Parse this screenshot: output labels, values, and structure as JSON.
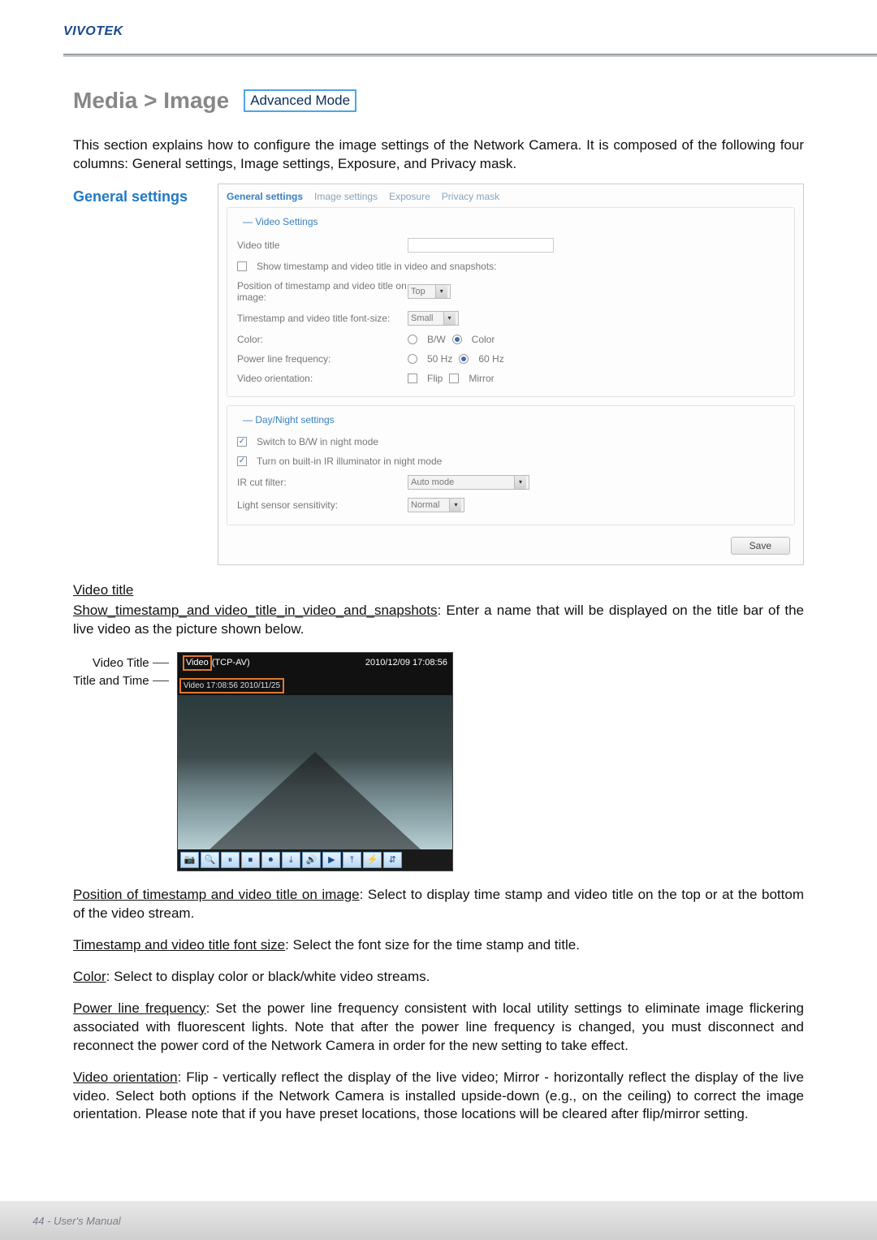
{
  "brand": "VIVOTEK",
  "page_title": "Media > Image",
  "mode_badge": "Advanced Mode",
  "intro": "This section explains how to configure the image settings of the Network Camera. It is composed of the following four columns: General settings, Image settings, Exposure, and Privacy mask.",
  "side_label": "General settings",
  "tabs": [
    "General settings",
    "Image settings",
    "Exposure",
    "Privacy mask"
  ],
  "video_settings": {
    "legend": "Video Settings",
    "video_title_label": "Video title",
    "show_ts_label": "Show timestamp and video title in video and snapshots:",
    "position_label": "Position of timestamp and video title on image:",
    "position_value": "Top",
    "font_label": "Timestamp and video title font-size:",
    "font_value": "Small",
    "color_label": "Color:",
    "color_bw": "B/W",
    "color_color": "Color",
    "plf_label": "Power line frequency:",
    "plf_50": "50 Hz",
    "plf_60": "60 Hz",
    "orient_label": "Video orientation:",
    "orient_flip": "Flip",
    "orient_mirror": "Mirror"
  },
  "daynight": {
    "legend": "Day/Night settings",
    "switch_bw": "Switch to B/W in night mode",
    "ir_illum": "Turn on built-in IR illuminator in night mode",
    "ircut_label": "IR cut filter:",
    "ircut_value": "Auto mode",
    "light_label": "Light sensor sensitivity:",
    "light_value": "Normal"
  },
  "save_label": "Save",
  "body": {
    "h_video_title": "Video title",
    "p_show_ts_u": "Show_timestamp_and video_title_in_video_and_snapshots",
    "p_show_ts_rest": ": Enter a name that will be displayed on the title bar of the live video as the picture shown below.",
    "vb_label1": "Video Title",
    "vb_label2": "Title and Time",
    "vt_box": "Video",
    "vt_rest": "(TCP-AV)",
    "vt_date": "2010/12/09  17:08:56",
    "vt_inner": "Video 17:08:56  2010/11/25",
    "p_pos_u": "Position of timestamp and video title on image",
    "p_pos_rest": ": Select to display time stamp and video title on the top or at the bottom of the video stream.",
    "p_font_u": "Timestamp and video title font size",
    "p_font_rest": ": Select the font size for the time stamp and title.",
    "p_color_u": "Color",
    "p_color_rest": ": Select to display color or black/white video streams.",
    "p_plf_u": "Power line frequency",
    "p_plf_rest": ": Set the power line frequency consistent with local utility settings to eliminate image flickering associated with fluorescent lights. Note that after the power line frequency is changed, you must disconnect and reconnect the power cord of the Network Camera in order for the new setting to take effect.",
    "p_orient_u": "Video orientation",
    "p_orient_rest": ": Flip - vertically reflect the display of the live video; Mirror - horizontally reflect the display of the live video. Select both options if the Network Camera is installed upside-down (e.g., on the ceiling) to correct the image orientation. Please note that if you have preset locations, those locations will be cleared after flip/mirror setting."
  },
  "toolbar_icons": [
    "📷",
    "🔍",
    "⏸",
    "⏹",
    "⏺",
    "⤓",
    "🔊",
    "▶",
    "⤒",
    "⚡",
    "⇵"
  ],
  "footer": "44 - User's Manual"
}
